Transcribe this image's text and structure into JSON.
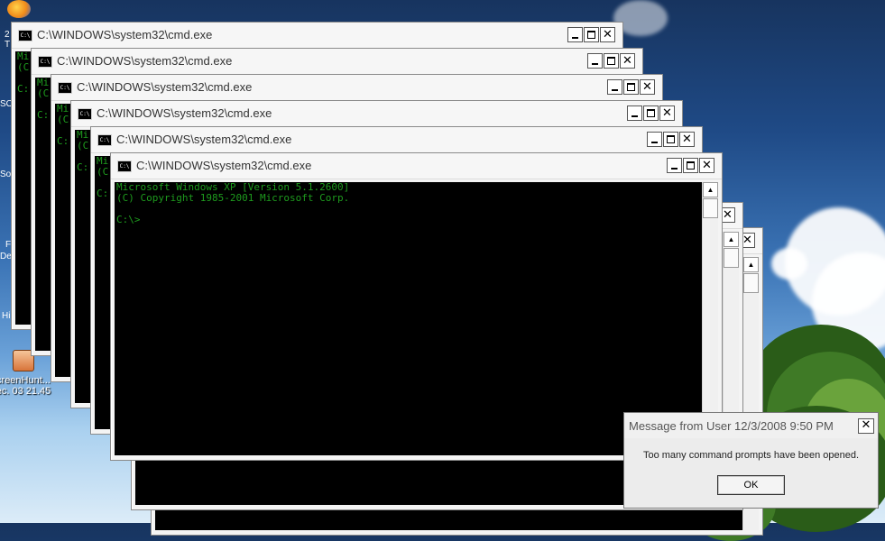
{
  "cmd": {
    "title": "C:\\WINDOWS\\system32\\cmd.exe",
    "icon_label": "C:\\",
    "line1": "Microsoft Windows XP [Version 5.1.2600]",
    "line2": "(C) Copyright 1985-2001 Microsoft Corp.",
    "prompt": "C:\\>",
    "partial_line1": "Mi",
    "partial_line2": "(C",
    "partial_prompt": "C:",
    "close_glyph": "✕",
    "scroll_up_glyph": "▲"
  },
  "desktop": {
    "icons": [
      {
        "name": "screenhunter",
        "label_line1": "creenHunt...",
        "label_line2": "ec. 03 21.45"
      }
    ],
    "partial_text": [
      "2",
      "T",
      "SO",
      "So",
      "F",
      "De",
      "Hi"
    ]
  },
  "message": {
    "title": "Message from User 12/3/2008 9:50 PM",
    "text": "Too many command prompts have been opened.",
    "ok_label": "OK",
    "close_glyph": "✕"
  },
  "colors": {
    "console_text": "#1e9b1e",
    "console_bg": "#000000"
  }
}
